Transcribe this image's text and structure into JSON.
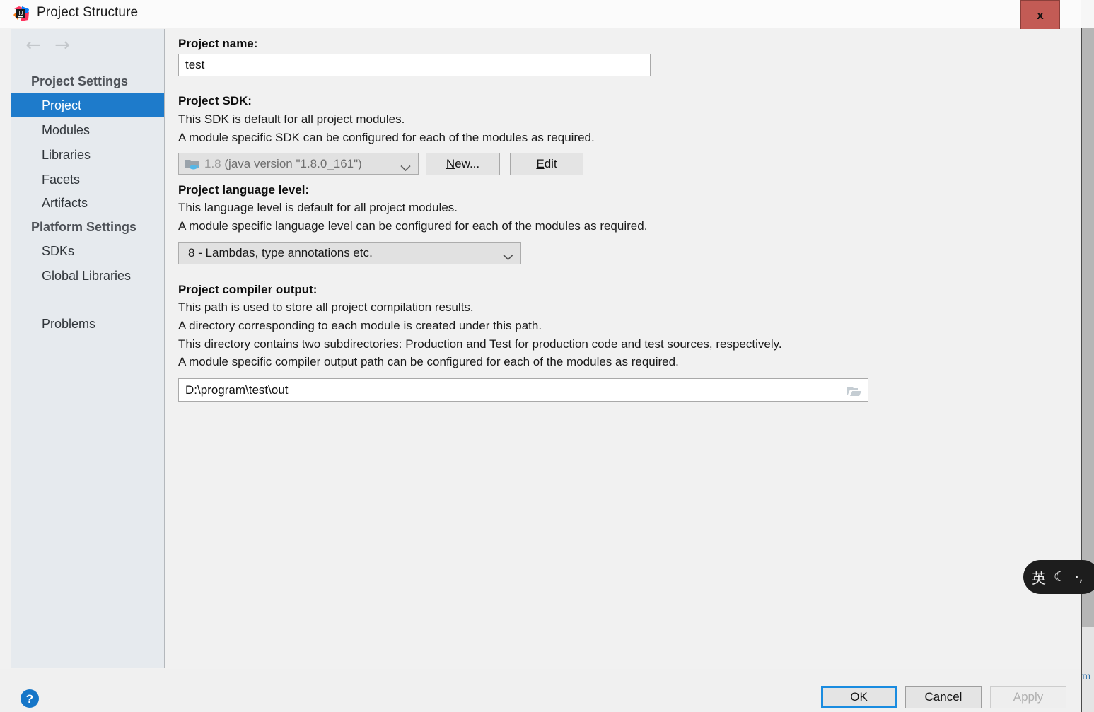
{
  "window": {
    "title": "Project Structure",
    "app_icon": "intellij-idea-icon",
    "close_label": "x"
  },
  "sidebar": {
    "nav": {
      "back_icon": "arrow-left-icon",
      "forward_icon": "arrow-right-icon"
    },
    "groups": [
      {
        "label": "Project Settings",
        "items": [
          {
            "label": "Project",
            "selected": true
          },
          {
            "label": "Modules",
            "selected": false
          },
          {
            "label": "Libraries",
            "selected": false
          },
          {
            "label": "Facets",
            "selected": false
          },
          {
            "label": "Artifacts",
            "selected": false
          }
        ]
      },
      {
        "label": "Platform Settings",
        "items": [
          {
            "label": "SDKs",
            "selected": false
          },
          {
            "label": "Global Libraries",
            "selected": false
          }
        ]
      }
    ],
    "extra_items": [
      {
        "label": "Problems",
        "selected": false
      }
    ]
  },
  "main": {
    "project_name": {
      "label": "Project name:",
      "value": "test"
    },
    "project_sdk": {
      "label": "Project SDK:",
      "desc_line_1": "This SDK is default for all project modules.",
      "desc_line_2": "A module specific SDK can be configured for each of the modules as required.",
      "selected_name": "1.8",
      "selected_version": "(java version \"1.8.0_161\")",
      "icon": "java-sdk-folder-icon",
      "new_button": "New...",
      "new_button_mnemonic": "N",
      "edit_button": "Edit",
      "edit_button_mnemonic": "E"
    },
    "language_level": {
      "label": "Project language level:",
      "desc_line_1": "This language level is default for all project modules.",
      "desc_line_2": "A module specific language level can be configured for each of the modules as required.",
      "selected": "8 - Lambdas, type annotations etc."
    },
    "compiler_output": {
      "label": "Project compiler output:",
      "desc_line_1": "This path is used to store all project compilation results.",
      "desc_line_2": "A directory corresponding to each module is created under this path.",
      "desc_line_3": "This directory contains two subdirectories: Production and Test for production code and test sources, respectively.",
      "desc_line_4": "A module specific compiler output path can be configured for each of the modules as required.",
      "value": "D:\\program\\test\\out",
      "browse_icon": "folder-open-icon"
    }
  },
  "footer": {
    "help_icon": "question-mark-icon",
    "ok": "OK",
    "cancel": "Cancel",
    "apply": "Apply",
    "apply_disabled": true
  },
  "ime_widget": {
    "language": "英",
    "mode_icon": "half-moon-icon",
    "punctuation": "·,"
  },
  "colors": {
    "accent": "#1e7bcb",
    "selection": "#1e7bcb",
    "close_button": "#c35b55",
    "sidebar_bg": "#e6eaee",
    "content_bg": "#f1f1f1",
    "help_blue": "#1676c8"
  }
}
